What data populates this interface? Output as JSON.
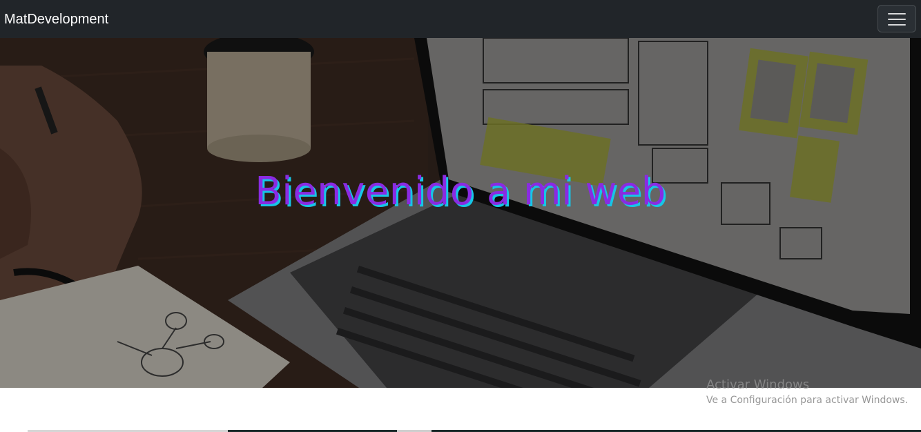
{
  "navbar": {
    "brand": "MatDevelopment",
    "toggler_icon": "hamburger-menu-icon",
    "background": "#212529"
  },
  "hero": {
    "title": "Bienvenido a mi web",
    "title_color": "#8a2be2",
    "title_shadow_color": "#16c6e6",
    "image_description_icon": "laptop-wireframe-photo"
  },
  "watermark": {
    "line1": "Activar Windows",
    "line2": "Ve a Configuración para activar Windows."
  }
}
